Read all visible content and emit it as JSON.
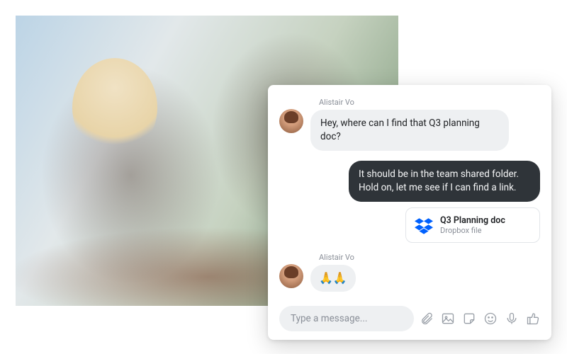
{
  "chat": {
    "messages": [
      {
        "sender": "Alistair Vo",
        "text": "Hey, where can I find that Q3 planning doc?",
        "side": "left",
        "avatar": true
      },
      {
        "text": "It should be in the team shared folder. Hold on, let me see if I can find a link.",
        "side": "right"
      }
    ],
    "attachment": {
      "title": "Q3 Planning doc",
      "subtitle": "Dropbox file"
    },
    "reaction": {
      "sender": "Alistair Vo",
      "emoji": "🙏🙏"
    },
    "composer": {
      "placeholder": "Type a message..."
    }
  },
  "colors": {
    "dropbox_blue": "#0061FE"
  }
}
